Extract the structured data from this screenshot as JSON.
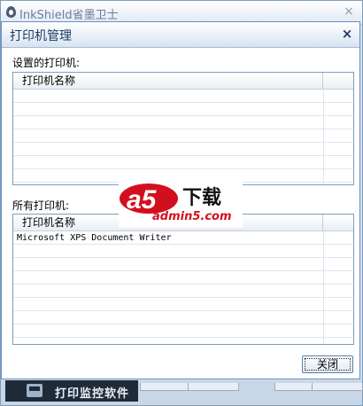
{
  "outer_window": {
    "title": "InkShield省墨卫士",
    "close_glyph": "×",
    "banner_text": "打印监控软件"
  },
  "dialog": {
    "title": "打印机管理",
    "close_glyph": "×",
    "configured_section": {
      "label": "设置的打印机:",
      "column_header": "打印机名称",
      "rows": []
    },
    "all_section": {
      "label": "所有打印机:",
      "column_header": "打印机名称",
      "rows": [
        "Microsoft XPS Document Writer"
      ]
    },
    "close_button_label": "关闭"
  },
  "watermark": {
    "logo_text": "a5",
    "suffix": "下载",
    "domain": "admin5.com"
  },
  "colors": {
    "border": "#7f9db9",
    "title_text": "#1f3b63",
    "watermark_red": "#d20f1e"
  },
  "icons": {
    "outer_logo": "inkdrop-icon",
    "banner_icon": "printer-icon"
  }
}
